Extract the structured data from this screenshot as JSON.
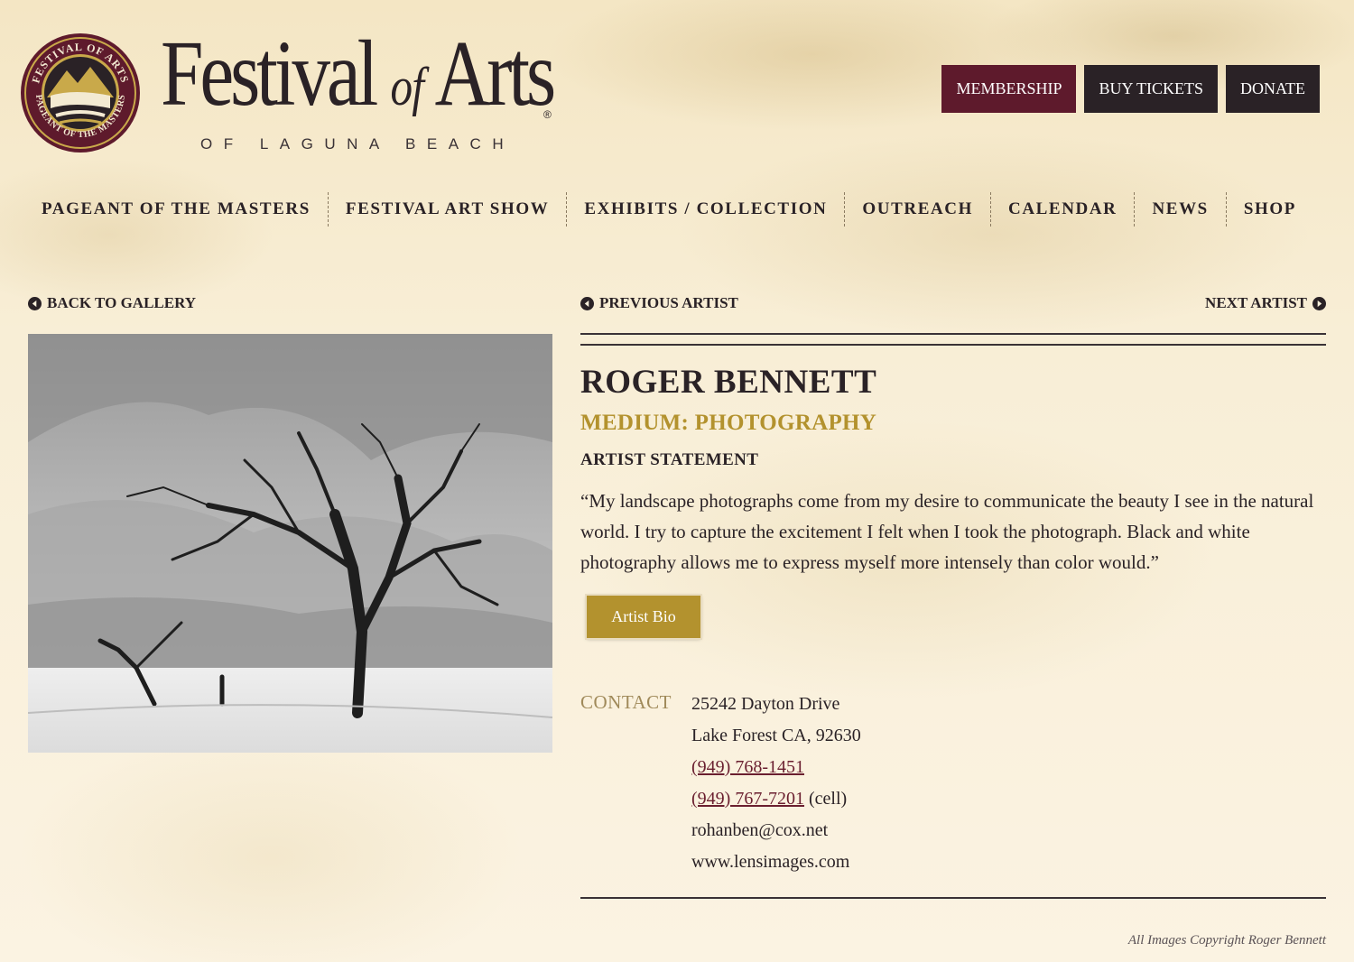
{
  "header": {
    "brand_title_main": "Festival",
    "brand_title_of": "of",
    "brand_title_end": "Arts",
    "brand_reg": "®",
    "brand_subtitle": "OF LAGUNA BEACH",
    "seal_text_top": "FESTIVAL OF ARTS",
    "seal_text_bottom": "PAGEANT OF THE MASTERS",
    "buttons": {
      "membership": "MEMBERSHIP",
      "buy_tickets": "BUY TICKETS",
      "donate": "DONATE"
    }
  },
  "nav": {
    "items": [
      "PAGEANT OF THE MASTERS",
      "FESTIVAL ART SHOW",
      "EXHIBITS / COLLECTION",
      "OUTREACH",
      "CALENDAR",
      "NEWS",
      "SHOP"
    ]
  },
  "gallery": {
    "back_label": "BACK TO GALLERY",
    "prev_label": "PREVIOUS ARTIST",
    "next_label": "NEXT ARTIST"
  },
  "artist": {
    "name": "ROGER BENNETT",
    "medium": "MEDIUM: PHOTOGRAPHY",
    "statement_heading": "ARTIST STATEMENT",
    "statement": "“My landscape photographs come from my desire to communicate the beauty I see in the natural world. I try to capture the excitement I felt when I took the photograph. Black and white photography allows me to express myself more intensely than color would.”",
    "bio_button": "Artist Bio"
  },
  "contact": {
    "label": "CONTACT",
    "address_line1": "25242 Dayton Drive",
    "address_line2": "Lake Forest CA, 92630",
    "phone": "(949) 768-1451",
    "cell": "(949) 767-7201",
    "cell_suffix": " (cell)",
    "email": "rohanben@cox.net",
    "website": "www.lensimages.com"
  },
  "footer": {
    "copyright": "All Images Copyright Roger Bennett"
  },
  "colors": {
    "accent_gold": "#b3922e",
    "membership_bg": "#5e1a2c",
    "dark": "#2a2226",
    "link": "#6a1f2f"
  }
}
